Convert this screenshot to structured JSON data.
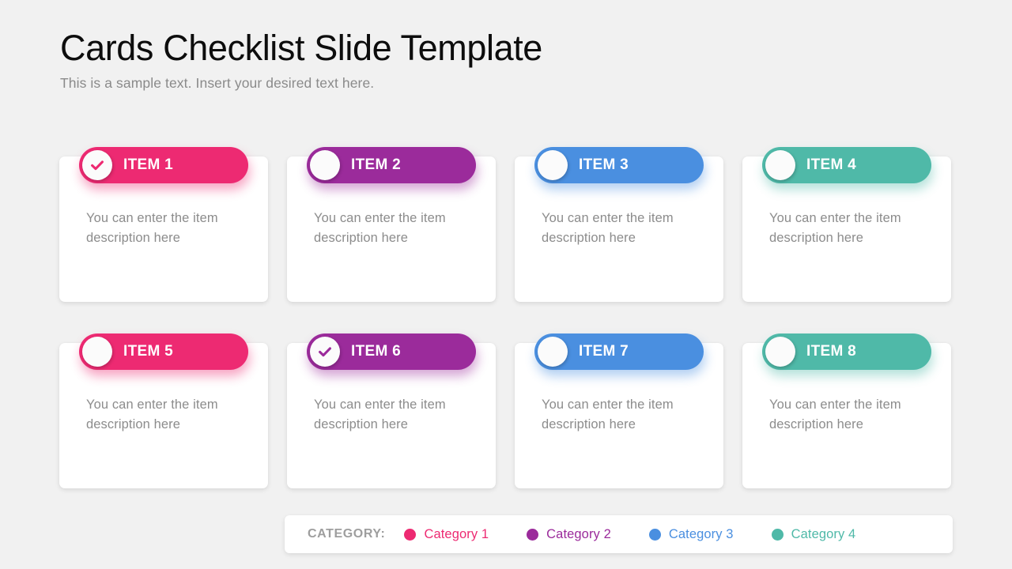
{
  "header": {
    "title": "Cards Checklist Slide Template",
    "subtitle": "This is a sample text. Insert your desired text here."
  },
  "colors": {
    "background": "#f1f1f1",
    "card": "#ffffff",
    "category_1": "#ed2a72",
    "category_2": "#9b2b9b",
    "category_3": "#4a8fe0",
    "category_4": "#4fb9a8",
    "title_text": "#0d0d0d",
    "subtitle_text": "#8a8a8a",
    "body_text": "#8c8c8c",
    "legend_title_text": "#9e9e9e"
  },
  "cards": [
    {
      "label": "ITEM 1",
      "description": "You can enter the item description here",
      "color": "#ed2a72",
      "checked": true,
      "category": "Category 1"
    },
    {
      "label": "ITEM 2",
      "description": "You can enter the item description here",
      "color": "#9b2b9b",
      "checked": false,
      "category": "Category 2"
    },
    {
      "label": "ITEM 3",
      "description": "You can enter the item description here",
      "color": "#4a8fe0",
      "checked": false,
      "category": "Category 3"
    },
    {
      "label": "ITEM 4",
      "description": "You can enter the item description here",
      "color": "#4fb9a8",
      "checked": false,
      "category": "Category 4"
    },
    {
      "label": "ITEM 5",
      "description": "You can enter the item description here",
      "color": "#ed2a72",
      "checked": false,
      "category": "Category 1"
    },
    {
      "label": "ITEM 6",
      "description": "You can enter the item description here",
      "color": "#9b2b9b",
      "checked": true,
      "category": "Category 2"
    },
    {
      "label": "ITEM 7",
      "description": "You can enter the item description here",
      "color": "#4a8fe0",
      "checked": false,
      "category": "Category 3"
    },
    {
      "label": "ITEM 8",
      "description": "You can enter the item description here",
      "color": "#4fb9a8",
      "checked": false,
      "category": "Category 4"
    }
  ],
  "legend": {
    "title": "CATEGORY:",
    "items": [
      {
        "label": "Category 1",
        "color": "#ed2a72"
      },
      {
        "label": "Category 2",
        "color": "#9b2b9b"
      },
      {
        "label": "Category 3",
        "color": "#4a8fe0"
      },
      {
        "label": "Category 4",
        "color": "#4fb9a8"
      }
    ]
  }
}
